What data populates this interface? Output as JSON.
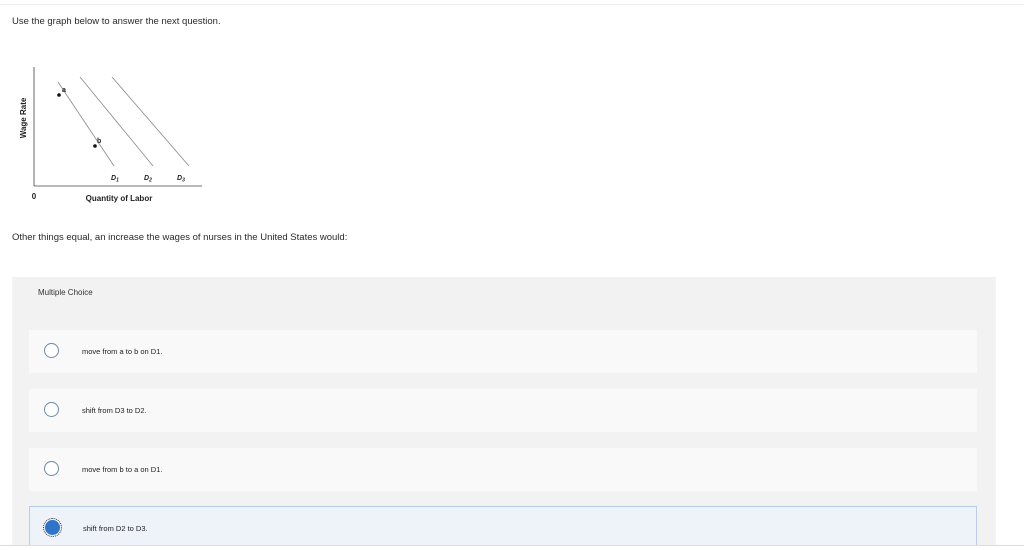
{
  "instruction": "Use the graph below to answer the next question.",
  "graph": {
    "y_axis_label": "Wage Rate",
    "x_axis_label": "Quantity of Labor",
    "origin_label": "0",
    "point_a_label": "a",
    "point_b_label": "b",
    "curve_labels": [
      "D",
      "D",
      "D"
    ],
    "curve_subscripts": [
      "1",
      "2",
      "3"
    ]
  },
  "question": "Other things equal, an increase the wages of nurses in the United States would:",
  "multiple_choice": {
    "label": "Multiple Choice",
    "options": [
      {
        "text": "move from a to b on D1.",
        "selected": false
      },
      {
        "text": "shift from D3 to D2.",
        "selected": false
      },
      {
        "text": "move from b to a on D1.",
        "selected": false
      },
      {
        "text": "shift from D2 to D3.",
        "selected": true
      }
    ]
  },
  "colors": {
    "panel_bg": "#f2f2f2",
    "option_bg": "#f9f9f9",
    "selected_bg": "#eef3fa",
    "radio_checked": "#2f74c8"
  }
}
